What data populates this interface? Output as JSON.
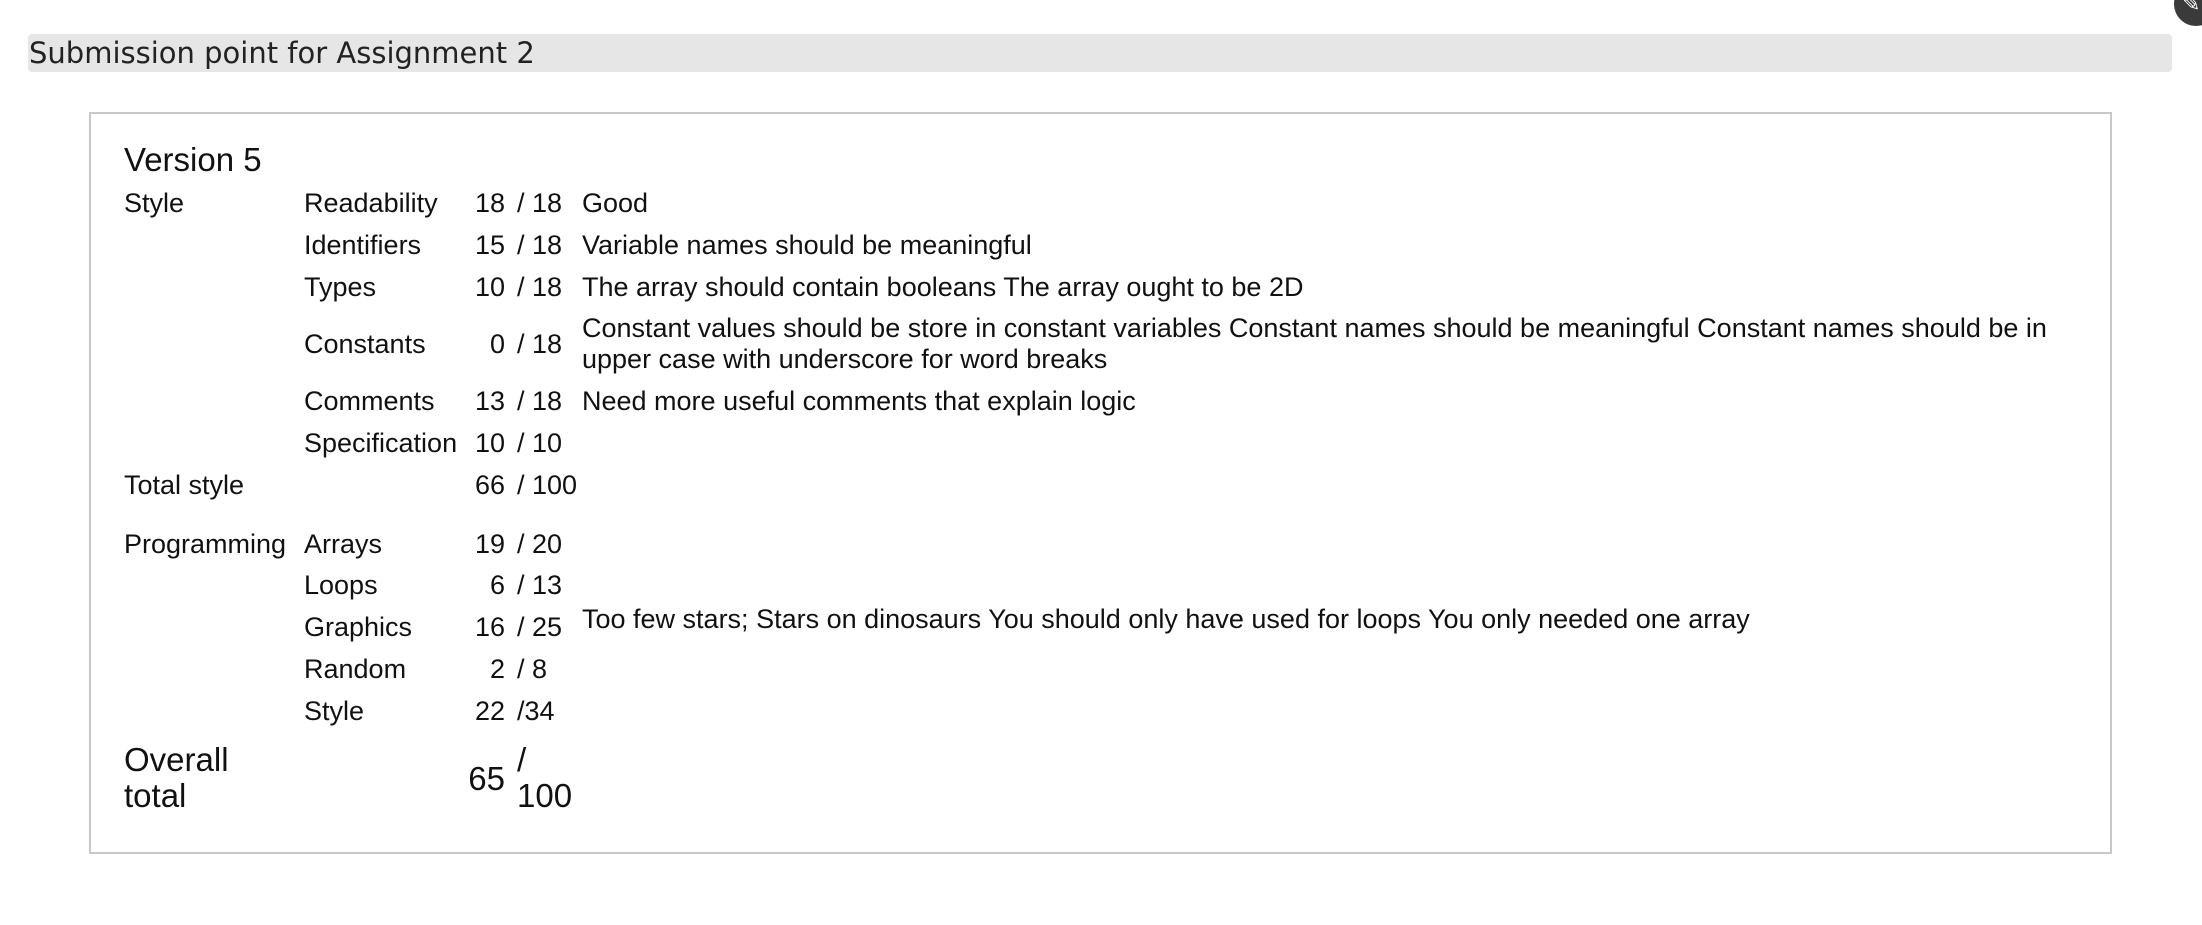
{
  "header": {
    "title": "Submission point for Assignment 2",
    "corner_icon": "edit-icon"
  },
  "version": {
    "title": "Version 5"
  },
  "style": {
    "section_label": "Style",
    "rows": [
      {
        "criterion": "Readability",
        "score": "18",
        "max": "/ 18",
        "comment": "Good"
      },
      {
        "criterion": "Identifiers",
        "score": "15",
        "max": "/ 18",
        "comment": "Variable names should be meaningful"
      },
      {
        "criterion": "Types",
        "score": "10",
        "max": "/ 18",
        "comment": "The array should contain booleans The array ought to be 2D"
      },
      {
        "criterion": "Constants",
        "score": "0",
        "max": "/ 18",
        "comment": "Constant values should be store in constant variables Constant names should be meaningful Constant names should be in upper case with underscore for word breaks"
      },
      {
        "criterion": "Comments",
        "score": "13",
        "max": "/ 18",
        "comment": "Need more useful comments that explain logic"
      },
      {
        "criterion": "Specification",
        "score": "10",
        "max": "/ 10",
        "comment": ""
      }
    ],
    "total_label": "Total style",
    "total_score": "66",
    "total_max": "/ 100"
  },
  "programming": {
    "section_label": "Programming",
    "rows": [
      {
        "criterion": "Arrays",
        "score": "19",
        "max": "/ 20"
      },
      {
        "criterion": "Loops",
        "score": "6",
        "max": "/ 13"
      },
      {
        "criterion": "Graphics",
        "score": "16",
        "max": "/ 25"
      },
      {
        "criterion": "Random",
        "score": "2",
        "max": "/ 8"
      },
      {
        "criterion": "Style",
        "score": "22",
        "max": "/34"
      }
    ],
    "comment": "Too few stars; Stars on dinosaurs You should only have used for loops You only needed one array"
  },
  "overall": {
    "label": "Overall total",
    "score": "65",
    "max": "/ 100"
  }
}
